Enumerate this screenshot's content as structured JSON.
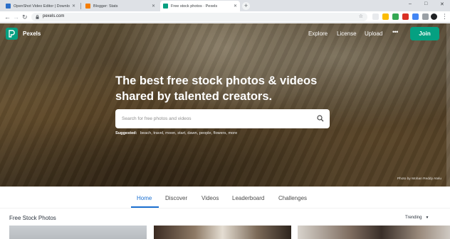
{
  "browser": {
    "tabs": [
      {
        "label": "OpenShot Video Editor | Downlo",
        "favicon_color": "#2b6fc9",
        "active": false
      },
      {
        "label": "Blogger: Stats",
        "favicon_color": "#f57d00",
        "active": false
      },
      {
        "label": "Free stock photos · Pexels",
        "favicon_color": "#05a081",
        "active": true
      }
    ],
    "new_tab_symbol": "+",
    "window_controls": {
      "minimize": "–",
      "maximize": "□",
      "close": "✕"
    },
    "nav": {
      "back": "←",
      "forward": "→",
      "reload": "↻"
    },
    "url": "pexels.com",
    "bookmark_icon": "☆"
  },
  "site": {
    "brand": "Pexels",
    "nav": [
      "Explore",
      "License",
      "Upload"
    ],
    "more": "•••",
    "join": "Join",
    "accent": "#05a081"
  },
  "hero": {
    "headline": "The best free stock photos & videos shared by talented creators.",
    "search_placeholder": "Search for free photos and videos",
    "suggested_label": "Suggested:",
    "suggested_tags": "beach, travel, moon, start, dawn, people, flowers, more",
    "credit": "Photo by Mohan Reddy Atelu"
  },
  "subnav": {
    "tabs": [
      "Home",
      "Discover",
      "Videos",
      "Leaderboard",
      "Challenges"
    ],
    "active": "Home",
    "active_color": "#1a6fd0"
  },
  "section": {
    "title": "Free Stock Photos",
    "sort": "Trending",
    "sort_caret": "▼"
  }
}
